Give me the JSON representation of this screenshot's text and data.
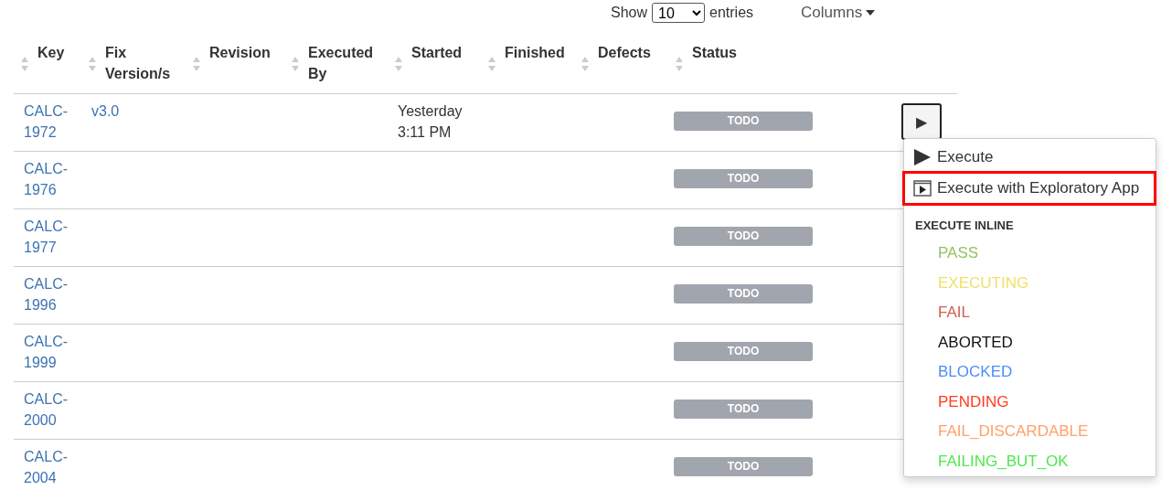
{
  "toolbar": {
    "show_label": "Show",
    "page_size": "10",
    "entries_label": "entries",
    "columns_button": "Columns"
  },
  "table": {
    "columns": [
      "Key",
      "Fix Version/s",
      "Revision",
      "Executed By",
      "Started",
      "Finished",
      "Defects",
      "Status"
    ],
    "rows": [
      {
        "key": "CALC-1972",
        "fix_version": "v3.0",
        "started": "Yesterday 3:11 PM",
        "status": "TODO",
        "run_button": "▶"
      },
      {
        "key": "CALC-1976",
        "status": "TODO"
      },
      {
        "key": "CALC-1977",
        "status": "TODO"
      },
      {
        "key": "CALC-1996",
        "status": "TODO"
      },
      {
        "key": "CALC-1999",
        "status": "TODO"
      },
      {
        "key": "CALC-2000",
        "status": "TODO"
      },
      {
        "key": "CALC-2004",
        "status": "TODO"
      }
    ]
  },
  "run_menu": {
    "items": [
      {
        "kind": "run",
        "label": "Execute",
        "highlighted": false
      },
      {
        "kind": "app",
        "label": "Execute with Exploratory App",
        "highlighted": true
      }
    ],
    "inline_header": "EXECUTE INLINE",
    "statuses": [
      {
        "label": "PASS",
        "color": "#95c160"
      },
      {
        "label": "EXECUTING",
        "color": "#f1e069"
      },
      {
        "label": "FAIL",
        "color": "#d45d52"
      },
      {
        "label": "ABORTED",
        "color": "#111111"
      },
      {
        "label": "BLOCKED",
        "color": "#4a8ff5"
      },
      {
        "label": "PENDING",
        "color": "#ff3b1f"
      },
      {
        "label": "FAIL_DISCARDABLE",
        "color": "#ffa06a"
      },
      {
        "label": "FAILING_BUT_OK",
        "color": "#4ee84e"
      }
    ]
  }
}
